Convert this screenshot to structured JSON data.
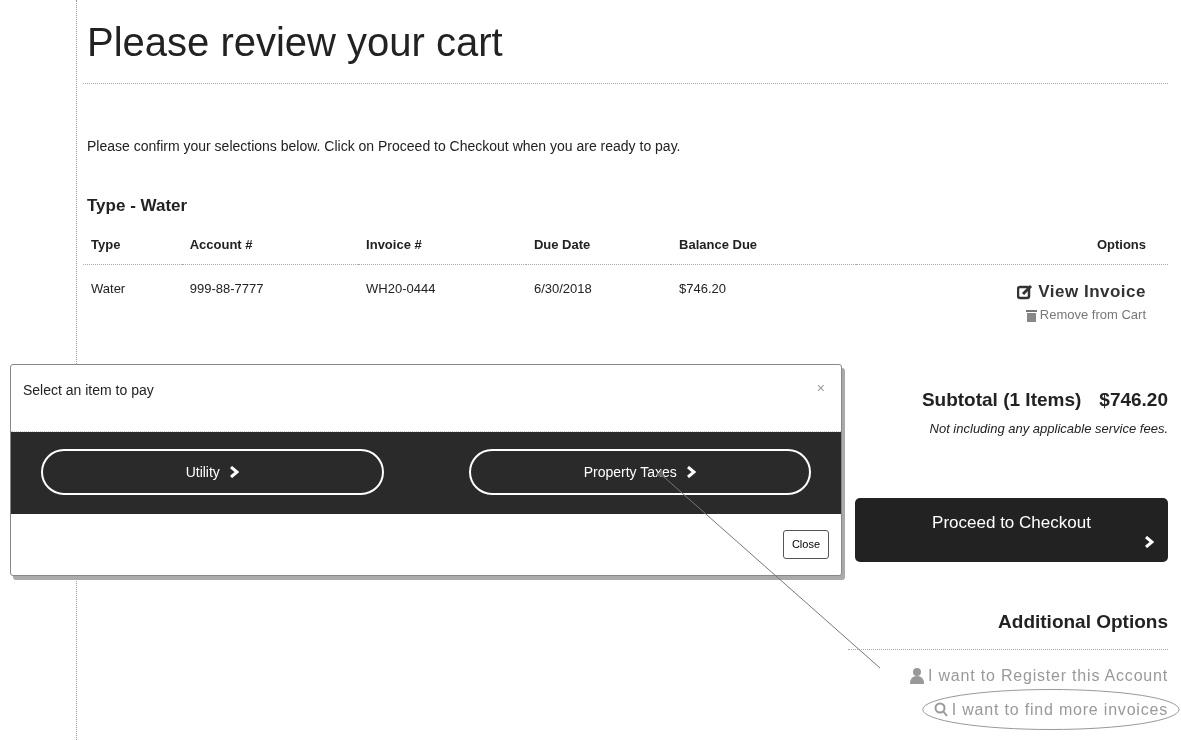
{
  "page": {
    "title": "Please review your cart",
    "instructions": "Please confirm your selections below. Click on Proceed to Checkout when you are ready to pay."
  },
  "cart_group": {
    "heading": "Type - Water",
    "columns": [
      "Type",
      "Account #",
      "Invoice #",
      "Due Date",
      "Balance Due",
      "Options"
    ],
    "rows": [
      {
        "cells": [
          "Water",
          "999-88-7777",
          "WH20-0444",
          "6/30/2018",
          "$746.20"
        ],
        "options": [
          {
            "kind": "view",
            "label": "View Invoice"
          },
          {
            "kind": "remove",
            "label": "Remove from Cart"
          }
        ]
      }
    ]
  },
  "summary": {
    "subtotal_label": "Subtotal (1 Items)",
    "subtotal_value": "$746.20",
    "note": "Not including any applicable service fees."
  },
  "checkout_button": "Proceed to Checkout",
  "additional_options": {
    "heading": "Additional Options",
    "links": [
      {
        "kind": "register",
        "label": "I want to Register this Account",
        "highlighted": false
      },
      {
        "kind": "find",
        "label": "I want to find more invoices",
        "highlighted": true
      }
    ]
  },
  "modal": {
    "title": "Select an item to pay",
    "close_glyph": "×",
    "choices": [
      "Utility",
      "Property Taxes"
    ],
    "footer_button": "Close"
  }
}
